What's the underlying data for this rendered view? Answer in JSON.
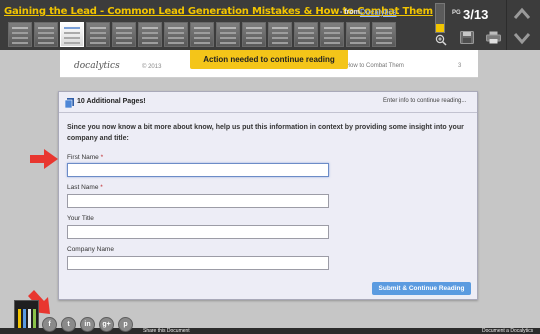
{
  "header": {
    "doc_title": "Gaining the Lead - Common Lead Generation Mistakes & How to Combat Them",
    "from_label": "- from",
    "publisher": "Docalytics",
    "page_label": "PG",
    "page_counter": "3/13",
    "thumbnail_count": 15,
    "current_thumbnail": 2,
    "zoom_level": 0.3
  },
  "document": {
    "logo": "docalytics",
    "copyright": "© 2013",
    "running_title": "takes and How to Combat Them",
    "page_number": "3",
    "action_banner": "Action needed to continue reading"
  },
  "form": {
    "title": "10 Additional Pages!",
    "enter_info": "Enter info to continue reading...",
    "intro": "Since you now know a bit more about know, help us put this information in context by providing some insight into your company and title:",
    "required_mark": "*",
    "fields": [
      {
        "label": "First Name",
        "required": true,
        "value": ""
      },
      {
        "label": "Last Name",
        "required": true,
        "value": ""
      },
      {
        "label": "Your Title",
        "required": false,
        "value": ""
      },
      {
        "label": "Company Name",
        "required": false,
        "value": ""
      }
    ],
    "submit_label": "Submit & Continue Reading"
  },
  "footer": {
    "share_text": "Share this Document",
    "powered_text": "Document a Docalytics",
    "social_icons": [
      "facebook-icon",
      "twitter-icon",
      "linkedin-icon",
      "google-plus-icon",
      "pinterest-icon"
    ],
    "social_glyphs": [
      "f",
      "t",
      "in",
      "g+",
      "p"
    ]
  },
  "colors": {
    "accent_yellow": "#f4c519",
    "title_yellow": "#f2c500",
    "submit_blue": "#5b9be0",
    "arrow_red": "#e8362f",
    "toolbar_dark": "#3c3c3c"
  }
}
